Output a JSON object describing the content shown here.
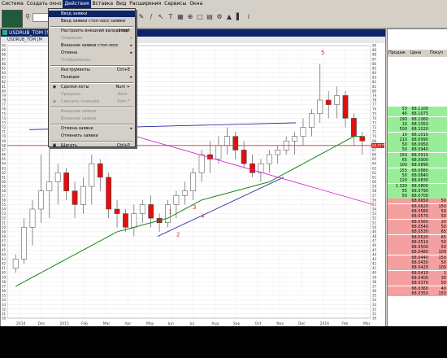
{
  "menubar": {
    "items": [
      "Система",
      "Создать окно",
      "Действия",
      "Вставка",
      "Вид",
      "Расширения",
      "Сервисы",
      "Окна"
    ],
    "active_index": 2
  },
  "toolbar": {
    "search_icon": "search-icon",
    "select_value": ""
  },
  "chart_window": {
    "title": "USDRUB_TOM [М] Граф",
    "subtitle": "USDRUB_TOM [М"
  },
  "menu": {
    "items": [
      {
        "label": "Ввод заявки",
        "shortcut": "",
        "state": "highlighted",
        "icon": ""
      },
      {
        "label": "Ввод заявки стоп-лосс заявки",
        "shortcut": "",
        "state": "enabled",
        "icon": ""
      },
      {
        "label": "Настроить внешний валидатор",
        "shortcut": "Insert",
        "state": "enabled",
        "icon": ""
      },
      {
        "label": "Операции",
        "shortcut": "",
        "state": "disabled",
        "arrow": true,
        "icon": ""
      },
      {
        "label": "Внешние заявки стоп-лосс",
        "shortcut": "",
        "state": "enabled",
        "arrow": true,
        "icon": ""
      },
      {
        "label": "Отмена",
        "shortcut": "",
        "state": "enabled",
        "arrow": true,
        "icon": ""
      },
      {
        "label": "Отображение",
        "shortcut": "",
        "state": "disabled",
        "icon": ""
      },
      {
        "label": "Инструменты",
        "shortcut": "Ctrl+E",
        "state": "enabled",
        "icon": ""
      },
      {
        "label": "Позиции",
        "shortcut": "",
        "state": "enabled",
        "arrow": true,
        "icon": ""
      },
      {
        "label": "Сделки-лоты",
        "shortcut": "Num +",
        "state": "enabled",
        "icon": "radio"
      },
      {
        "label": "Продажа",
        "shortcut": "Num -",
        "state": "disabled",
        "icon": ""
      },
      {
        "label": "Сменить позицию",
        "shortcut": "Num *",
        "state": "disabled",
        "icon": "radio"
      },
      {
        "label": "Внешние заявки",
        "shortcut": "",
        "state": "disabled",
        "icon": ""
      },
      {
        "label": "Внешние заявки",
        "shortcut": "",
        "state": "disabled",
        "icon": ""
      },
      {
        "label": "Отмена заявки",
        "shortcut": "",
        "state": "enabled",
        "arrow": true,
        "icon": ""
      },
      {
        "label": "Отменить заявки",
        "shortcut": "",
        "state": "enabled",
        "icon": ""
      },
      {
        "label": "Шагать",
        "shortcut": "Ctrl+P",
        "state": "enabled",
        "icon": "step"
      }
    ]
  },
  "chart_data": {
    "type": "candlestick",
    "x_labels": [
      "2014",
      "Dec",
      "2015",
      "Feb",
      "Mar",
      "Apr",
      "May",
      "Jun",
      "Jul",
      "Aug",
      "Sep",
      "Oct",
      "Nov",
      "Dec",
      "2016",
      "Feb",
      "Mar"
    ],
    "y_ticks": [
      30,
      31,
      32,
      33,
      34,
      35,
      36,
      37,
      38,
      39,
      40,
      41,
      42,
      43,
      44,
      45,
      46,
      47,
      48,
      49,
      50,
      51,
      52,
      53,
      54,
      55,
      56,
      57,
      58,
      59,
      60,
      61,
      62,
      63,
      64,
      65,
      66,
      67,
      68,
      69,
      70,
      71,
      72,
      73,
      74,
      75,
      76,
      77,
      78,
      79,
      80,
      81,
      82,
      83,
      84,
      85,
      86,
      87,
      88,
      89,
      90
    ],
    "ylim": [
      30,
      90
    ],
    "price_label": "69.0775",
    "annotations": [
      "1",
      "2",
      "3",
      "4",
      "5"
    ],
    "candles": [
      [
        41,
        44,
        40,
        43
      ],
      [
        43,
        52,
        42,
        50
      ],
      [
        50,
        56,
        46,
        54
      ],
      [
        54,
        66,
        51,
        58
      ],
      [
        58,
        70,
        52,
        60
      ],
      [
        60,
        64,
        55,
        62
      ],
      [
        62,
        63,
        56,
        58
      ],
      [
        58,
        60,
        52,
        55
      ],
      [
        55,
        61,
        53,
        59
      ],
      [
        59,
        66,
        55,
        64
      ],
      [
        64,
        65,
        58,
        61
      ],
      [
        61,
        62,
        52,
        54
      ],
      [
        54,
        56,
        50,
        53
      ],
      [
        53,
        54,
        49,
        50
      ],
      [
        50,
        55,
        48,
        53
      ],
      [
        53,
        56,
        51,
        55
      ],
      [
        55,
        57,
        50,
        52
      ],
      [
        52,
        53,
        49,
        51
      ],
      [
        51,
        56,
        50,
        55
      ],
      [
        55,
        58,
        52,
        57
      ],
      [
        57,
        60,
        55,
        58
      ],
      [
        58,
        63,
        56,
        62
      ],
      [
        62,
        67,
        60,
        66
      ],
      [
        66,
        69,
        62,
        65
      ],
      [
        65,
        70,
        64,
        68
      ],
      [
        68,
        72,
        66,
        70
      ],
      [
        70,
        71,
        65,
        67
      ],
      [
        67,
        69,
        63,
        64
      ],
      [
        64,
        66,
        61,
        62
      ],
      [
        62,
        65,
        60,
        64
      ],
      [
        64,
        67,
        62,
        66
      ],
      [
        66,
        68,
        64,
        67
      ],
      [
        67,
        70,
        66,
        69
      ],
      [
        69,
        71,
        66,
        70
      ],
      [
        70,
        74,
        68,
        72
      ],
      [
        72,
        76,
        70,
        75
      ],
      [
        75,
        86,
        73,
        78
      ],
      [
        78,
        80,
        74,
        77
      ],
      [
        77,
        81,
        74,
        79
      ],
      [
        79,
        80,
        72,
        74
      ],
      [
        74,
        75,
        68,
        70
      ],
      [
        70,
        71,
        66,
        69
      ]
    ],
    "moving_average": [
      37,
      38,
      39,
      40,
      41,
      42,
      43,
      44,
      45,
      46,
      47,
      48,
      49,
      49.5,
      50,
      50.5,
      51,
      51.5,
      52,
      53,
      54,
      55,
      56,
      56.5,
      57,
      57.5,
      58,
      58.5,
      59,
      59.5,
      60,
      61,
      62,
      63,
      64,
      65,
      66,
      67,
      68,
      69,
      70,
      70
    ],
    "lines": [
      {
        "color": "#1a1aa0",
        "from": [
          27,
          71.5
        ],
        "to": [
          355,
          73
        ]
      },
      {
        "color": "#1a1aa0",
        "from": [
          185,
          48
        ],
        "to": [
          340,
          61
        ]
      },
      {
        "color": "#d020d0",
        "from": [
          100,
          73
        ],
        "to": [
          450,
          55
        ]
      },
      {
        "color": "#d03030",
        "from": [
          0,
          68
        ],
        "to": [
          450,
          68
        ]
      }
    ],
    "colors": {
      "up": "#ffffff",
      "down": "#e01010",
      "ma": "#1a8a1a",
      "text": "#d03030"
    }
  },
  "order_book": {
    "headers": [
      "Продаж",
      "Цена",
      "Покуп"
    ],
    "rows": [
      {
        "sell": "53",
        "price": "68.1100",
        "buy": ""
      },
      {
        "sell": "46",
        "price": "68.1075",
        "buy": ""
      },
      {
        "sell": "290",
        "price": "68.1060",
        "buy": ""
      },
      {
        "sell": "10",
        "price": "68.1050",
        "buy": ""
      },
      {
        "sell": "500",
        "price": "68.1020",
        "buy": ""
      },
      {
        "sell": "10",
        "price": "68.1010",
        "buy": ""
      },
      {
        "sell": "210",
        "price": "68.0990",
        "buy": ""
      },
      {
        "sell": "50",
        "price": "68.0950",
        "buy": ""
      },
      {
        "sell": "50",
        "price": "68.0940",
        "buy": ""
      },
      {
        "sell": "150",
        "price": "68.0910",
        "buy": ""
      },
      {
        "sell": "65",
        "price": "68.0900",
        "buy": ""
      },
      {
        "sell": "100",
        "price": "68.0890",
        "buy": ""
      },
      {
        "sell": "155",
        "price": "68.0880",
        "buy": ""
      },
      {
        "sell": "50",
        "price": "68.0840",
        "buy": ""
      },
      {
        "sell": "220",
        "price": "68.0830",
        "buy": ""
      },
      {
        "sell": "1 330",
        "price": "68.0800",
        "buy": ""
      },
      {
        "sell": "55",
        "price": "68.0790",
        "buy": ""
      },
      {
        "sell": "50",
        "price": "68.0700",
        "buy": ""
      },
      {
        "sell": "",
        "price": "68.0650",
        "buy": "50"
      },
      {
        "sell": "",
        "price": "68.0620",
        "buy": "150"
      },
      {
        "sell": "",
        "price": "68.0580",
        "buy": "50"
      },
      {
        "sell": "",
        "price": "68.0570",
        "buy": "50"
      },
      {
        "sell": "",
        "price": "68.0560",
        "buy": "20"
      },
      {
        "sell": "",
        "price": "68.0540",
        "buy": "50"
      },
      {
        "sell": "",
        "price": "68.0530",
        "buy": "65"
      },
      {
        "sell": "",
        "price": "68.0520",
        "buy": "65"
      },
      {
        "sell": "",
        "price": "68.0510",
        "buy": "50"
      },
      {
        "sell": "",
        "price": "68.0500",
        "buy": "50"
      },
      {
        "sell": "",
        "price": "68.0480",
        "buy": "100"
      },
      {
        "sell": "",
        "price": "68.0440",
        "buy": "150"
      },
      {
        "sell": "",
        "price": "68.0430",
        "buy": "50"
      },
      {
        "sell": "",
        "price": "68.0420",
        "buy": "100"
      },
      {
        "sell": "",
        "price": "68.0410",
        "buy": "1"
      },
      {
        "sell": "",
        "price": "68.0400",
        "buy": "30"
      },
      {
        "sell": "",
        "price": "68.0370",
        "buy": "50"
      },
      {
        "sell": "",
        "price": "68.0360",
        "buy": "40"
      },
      {
        "sell": "",
        "price": "68.0350",
        "buy": "150"
      }
    ],
    "sell_color": "#98ee98",
    "buy_color": "#f4a0a0"
  }
}
